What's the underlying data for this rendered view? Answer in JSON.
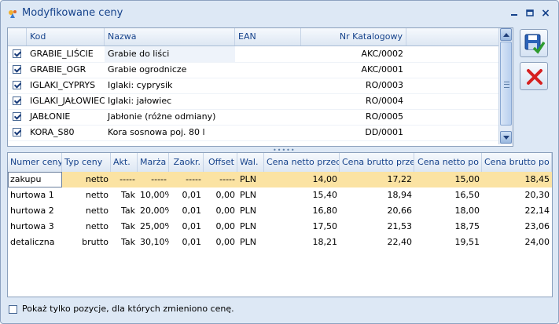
{
  "window": {
    "title": "Modyfikowane ceny",
    "minimize_icon": "minimize-icon",
    "restore_icon": "restore-icon",
    "close_label": "×"
  },
  "items_table": {
    "headers": [
      "Kod",
      "Nazwa",
      "EAN",
      "Nr Katalogowy"
    ],
    "rows": [
      {
        "checked": true,
        "kod": "GRABIE_LIŚCIE",
        "nazwa": "Grabie do liści",
        "ean": "",
        "nr_kat": "AKC/0002"
      },
      {
        "checked": true,
        "kod": "GRABIE_OGR",
        "nazwa": "Grabie ogrodnicze",
        "ean": "",
        "nr_kat": "AKC/0001"
      },
      {
        "checked": true,
        "kod": "IGLAKI_CYPRYS",
        "nazwa": "Iglaki: cyprysik",
        "ean": "",
        "nr_kat": "RO/0003"
      },
      {
        "checked": true,
        "kod": "IGLAKI_JAŁOWIEC",
        "nazwa": "Iglaki: jałowiec",
        "ean": "",
        "nr_kat": "RO/0004"
      },
      {
        "checked": true,
        "kod": "JABŁONIE",
        "nazwa": "Jabłonie (różne odmiany)",
        "ean": "",
        "nr_kat": "RO/0005"
      },
      {
        "checked": true,
        "kod": "KORA_S80",
        "nazwa": "Kora sosnowa poj. 80 l",
        "ean": "",
        "nr_kat": "DD/0001"
      }
    ]
  },
  "side_buttons": {
    "save_icon": "save-confirm-icon",
    "cancel_icon": "cancel-x-icon"
  },
  "prices_table": {
    "headers": [
      "Numer ceny",
      "Typ ceny",
      "Akt.",
      "Marża",
      "Zaokr.",
      "Offset",
      "Wal.",
      "Cena netto przed",
      "Cena brutto przed",
      "Cena netto po",
      "Cena brutto po"
    ],
    "rows": [
      {
        "numer": "zakupu",
        "typ": "netto",
        "akt": "-----",
        "marza": "-----",
        "zaokr": "-----",
        "offset": "-----",
        "wal": "PLN",
        "netto_przed": "14,00",
        "brutto_przed": "17,22",
        "netto_po": "15,00",
        "brutto_po": "18,45",
        "selected": true
      },
      {
        "numer": "hurtowa 1",
        "typ": "netto",
        "akt": "Tak",
        "marza": "10,00%",
        "zaokr": "0,01",
        "offset": "0,00",
        "wal": "PLN",
        "netto_przed": "15,40",
        "brutto_przed": "18,94",
        "netto_po": "16,50",
        "brutto_po": "20,30"
      },
      {
        "numer": "hurtowa 2",
        "typ": "netto",
        "akt": "Tak",
        "marza": "20,00%",
        "zaokr": "0,01",
        "offset": "0,00",
        "wal": "PLN",
        "netto_przed": "16,80",
        "brutto_przed": "20,66",
        "netto_po": "18,00",
        "brutto_po": "22,14"
      },
      {
        "numer": "hurtowa 3",
        "typ": "netto",
        "akt": "Tak",
        "marza": "25,00%",
        "zaokr": "0,01",
        "offset": "0,00",
        "wal": "PLN",
        "netto_przed": "17,50",
        "brutto_przed": "21,53",
        "netto_po": "18,75",
        "brutto_po": "23,06"
      },
      {
        "numer": "detaliczna",
        "typ": "brutto",
        "akt": "Tak",
        "marza": "30,10%",
        "zaokr": "0,01",
        "offset": "0,00",
        "wal": "PLN",
        "netto_przed": "18,21",
        "brutto_przed": "22,40",
        "netto_po": "19,51",
        "brutto_po": "24,00"
      }
    ]
  },
  "footer": {
    "checkbox_label": "Pokaż tylko pozycje, dla których zmieniono cenę.",
    "checked": false
  },
  "colors": {
    "selected_row": "#fbe3a3",
    "header_text": "#15428b",
    "save_icon_primary": "#1e4f9a",
    "save_icon_check": "#2e9b2e",
    "cancel_icon": "#d62020"
  }
}
